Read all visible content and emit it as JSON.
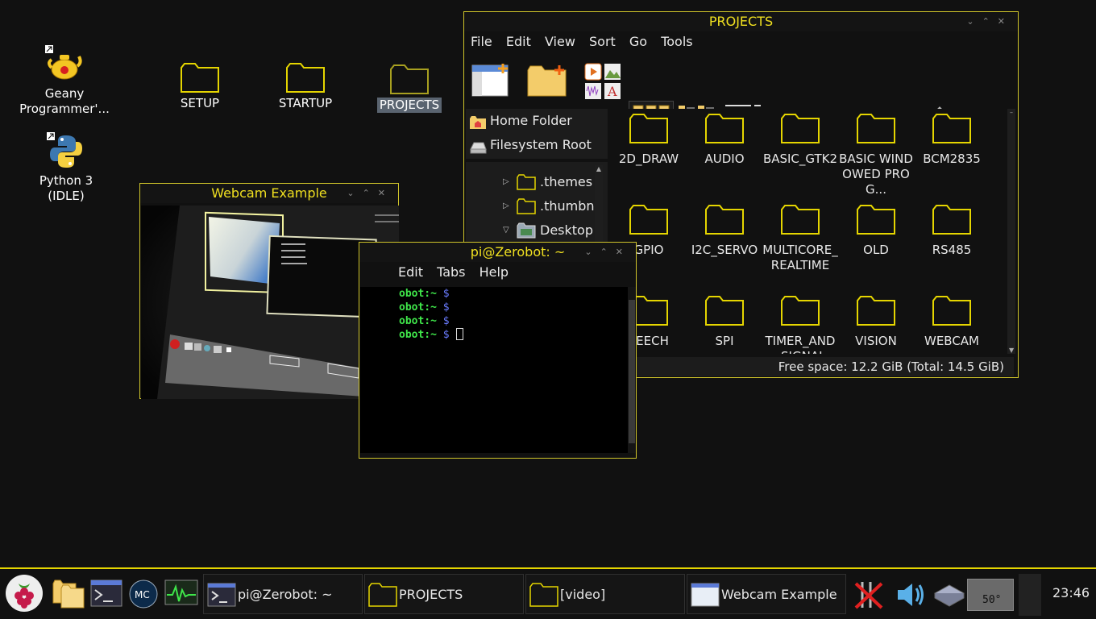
{
  "desktop": {
    "icons": [
      {
        "label": "Geany Programmer'...",
        "icon": "geany-icon"
      },
      {
        "label": "Python 3 (IDLE)",
        "icon": "python-icon"
      },
      {
        "label": "SETUP",
        "icon": "folder-icon"
      },
      {
        "label": "STARTUP",
        "icon": "folder-icon"
      },
      {
        "label": "PROJECTS",
        "icon": "folder-icon"
      }
    ]
  },
  "file_manager": {
    "title": "PROJECTS",
    "menu": [
      "File",
      "Edit",
      "View",
      "Sort",
      "Go",
      "Tools"
    ],
    "places": [
      "Home Folder",
      "Filesystem Root"
    ],
    "tree": [
      {
        "label": ".themes",
        "expanded": false
      },
      {
        "label": ".thumbna",
        "expanded": false
      },
      {
        "label": "Desktop",
        "expanded": true
      }
    ],
    "folders": [
      "2D_DRAW",
      "AUDIO",
      "BASIC_GTK2",
      "BASIC WINDOWED PROG...",
      "BCM2835",
      "GPIO",
      "I2C_SERVO",
      "MULTICORE_REALTIME",
      "OLD",
      "RS485",
      "PEECH",
      "SPI",
      "TIMER_AND_SIGNAL",
      "VISION",
      "WEBCAM"
    ],
    "status": "Free space: 12.2 GiB (Total: 14.5 GiB)"
  },
  "webcam": {
    "title": "Webcam Example"
  },
  "terminal": {
    "title": "pi@Zerobot: ~",
    "menu": [
      "Edit",
      "Tabs",
      "Help"
    ],
    "prompt_user": "obot:~",
    "prompt_sym": "$",
    "line_count": 4
  },
  "taskbar": {
    "tasks": [
      "pi@Zerobot: ~",
      "PROJECTS",
      "[video]",
      "Webcam Example"
    ],
    "cpu_temp": "50°",
    "clock": "23:46"
  },
  "colors": {
    "accent": "#e5d500",
    "folder_outline": "#e5d500",
    "prompt_green": "#3fe64a",
    "prompt_blue": "#6a7cff"
  }
}
